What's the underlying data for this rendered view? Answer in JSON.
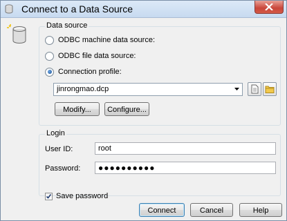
{
  "window": {
    "title": "Connect to a Data Source"
  },
  "icons": {
    "app": "database-icon",
    "close": "close-icon",
    "combo_arrow": "chevron-down-icon",
    "edit_profile": "document-icon",
    "browse_profile": "folder-icon",
    "save_check": "checkmark-icon"
  },
  "data_source": {
    "legend": "Data source",
    "options": [
      {
        "label": "ODBC machine data source:",
        "selected": false
      },
      {
        "label": "ODBC file data source:",
        "selected": false
      },
      {
        "label": "Connection profile:",
        "selected": true
      }
    ],
    "profile_value": "jinrongmao.dcp",
    "modify_label": "Modify...",
    "configure_label": "Configure..."
  },
  "login": {
    "legend": "Login",
    "user_id_label": "User ID:",
    "user_id_value": "root",
    "password_label": "Password:",
    "password_masked": "●●●●●●●●●●",
    "save_password_label": "Save password",
    "save_password_checked": true
  },
  "buttons": {
    "connect": "Connect",
    "cancel": "Cancel",
    "help": "Help"
  }
}
